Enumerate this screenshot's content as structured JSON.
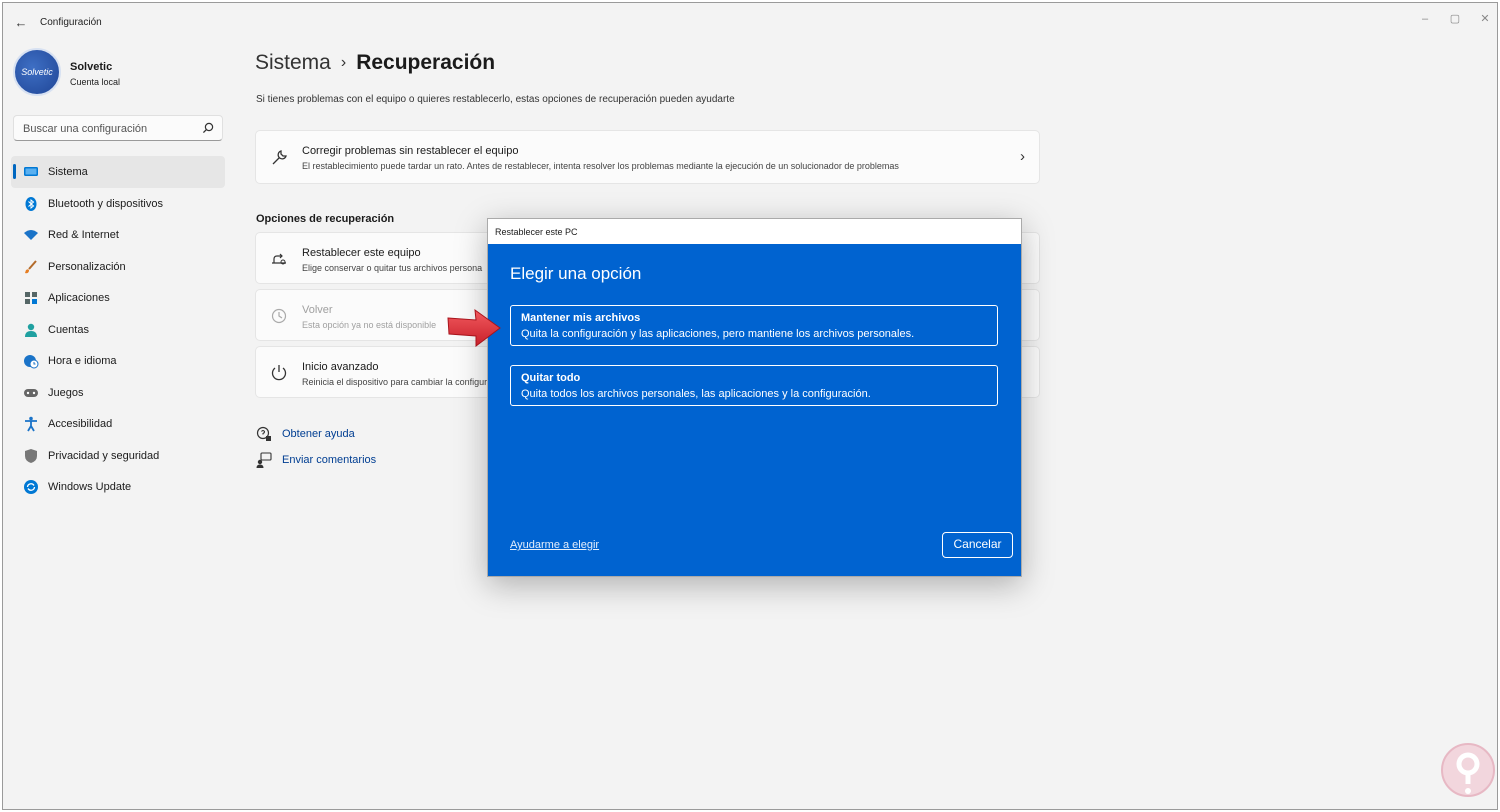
{
  "titlebar": {
    "app_title": "Configuración",
    "back_icon": "arrow-left-icon",
    "controls": [
      "minimize",
      "maximize",
      "close"
    ]
  },
  "profile": {
    "avatar_text": "Solvetic",
    "name": "Solvetic",
    "account_type": "Cuenta local"
  },
  "search": {
    "placeholder": "Buscar una configuración",
    "icon": "search-icon"
  },
  "sidebar": {
    "selected_index": 0,
    "items": [
      {
        "label": "Sistema",
        "icon": "monitor-icon"
      },
      {
        "label": "Bluetooth y dispositivos",
        "icon": "bluetooth-icon"
      },
      {
        "label": "Red & Internet",
        "icon": "wifi-icon"
      },
      {
        "label": "Personalización",
        "icon": "brush-icon"
      },
      {
        "label": "Aplicaciones",
        "icon": "apps-icon"
      },
      {
        "label": "Cuentas",
        "icon": "person-icon"
      },
      {
        "label": "Hora e idioma",
        "icon": "globe-clock-icon"
      },
      {
        "label": "Juegos",
        "icon": "gamepad-icon"
      },
      {
        "label": "Accesibilidad",
        "icon": "accessibility-icon"
      },
      {
        "label": "Privacidad y seguridad",
        "icon": "shield-icon"
      },
      {
        "label": "Windows Update",
        "icon": "update-icon"
      }
    ]
  },
  "main": {
    "breadcrumb_parent": "Sistema",
    "breadcrumb_sep": "›",
    "breadcrumb_current": "Recuperación",
    "description": "Si tienes problemas con el equipo o quieres restablecerlo, estas opciones de recuperación pueden ayudarte",
    "fix_card": {
      "title": "Corregir problemas sin restablecer el equipo",
      "subtitle": "El restablecimiento puede tardar un rato. Antes de restablecer, intenta resolver los problemas mediante la ejecución de un solucionador de problemas",
      "icon": "wrench-icon"
    },
    "section_title": "Opciones de recuperación",
    "recovery_options": [
      {
        "title": "Restablecer este equipo",
        "subtitle": "Elige conservar o quitar tus archivos persona",
        "icon": "reset-pc-icon",
        "enabled": true
      },
      {
        "title": "Volver",
        "subtitle": "Esta opción ya no está disponible",
        "icon": "history-icon",
        "enabled": false
      },
      {
        "title": "Inicio avanzado",
        "subtitle": "Reinicia el dispositivo para cambiar la configura",
        "icon": "advanced-startup-icon",
        "enabled": true
      }
    ],
    "links": [
      {
        "label": "Obtener ayuda",
        "icon": "help-icon"
      },
      {
        "label": "Enviar comentarios",
        "icon": "feedback-icon"
      }
    ]
  },
  "dialog": {
    "window_title": "Restablecer este PC",
    "heading": "Elegir una opción",
    "options": [
      {
        "title": "Mantener mis archivos",
        "subtitle": "Quita la configuración y las aplicaciones, pero mantiene los archivos personales."
      },
      {
        "title": "Quitar todo",
        "subtitle": "Quita todos los archivos personales, las aplicaciones y la configuración."
      }
    ],
    "help_link": "Ayudarme a elegir",
    "cancel_label": "Cancelar",
    "background_color": "#0063d0"
  },
  "annotation": {
    "arrow_color": "#e8333a",
    "points_to": "Mantener mis archivos"
  },
  "colors": {
    "accent": "#0067c0",
    "window_bg": "#f3f3f3",
    "card_bg": "#fbfbfb",
    "link": "#003e92"
  }
}
